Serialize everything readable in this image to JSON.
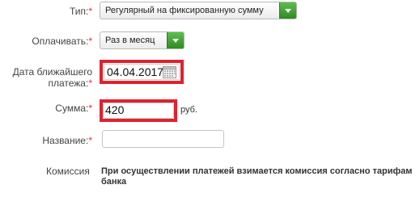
{
  "form": {
    "type": {
      "label": "Тип:",
      "required": "*",
      "value": "Регулярный на фиксированную сумму"
    },
    "pay": {
      "label": "Оплачивать:",
      "required": "*",
      "value": "Раз в месяц"
    },
    "date": {
      "label_line1": "Дата ближайшего",
      "label_line2": "платежа:",
      "required": "*",
      "value": "04.04.2017",
      "icon": "calendar-icon"
    },
    "amount": {
      "label": "Сумма:",
      "required": "*",
      "value": "420",
      "unit": "руб."
    },
    "name": {
      "label": "Название:",
      "required": "*",
      "value": ""
    },
    "commission": {
      "label": "Комиссия",
      "text": "При осуществлении платежей взимается комиссия согласно тарифам банка"
    }
  },
  "colors": {
    "highlight": "#e0222e",
    "select_arrow": "#3a9a2c",
    "required": "#e03030"
  }
}
